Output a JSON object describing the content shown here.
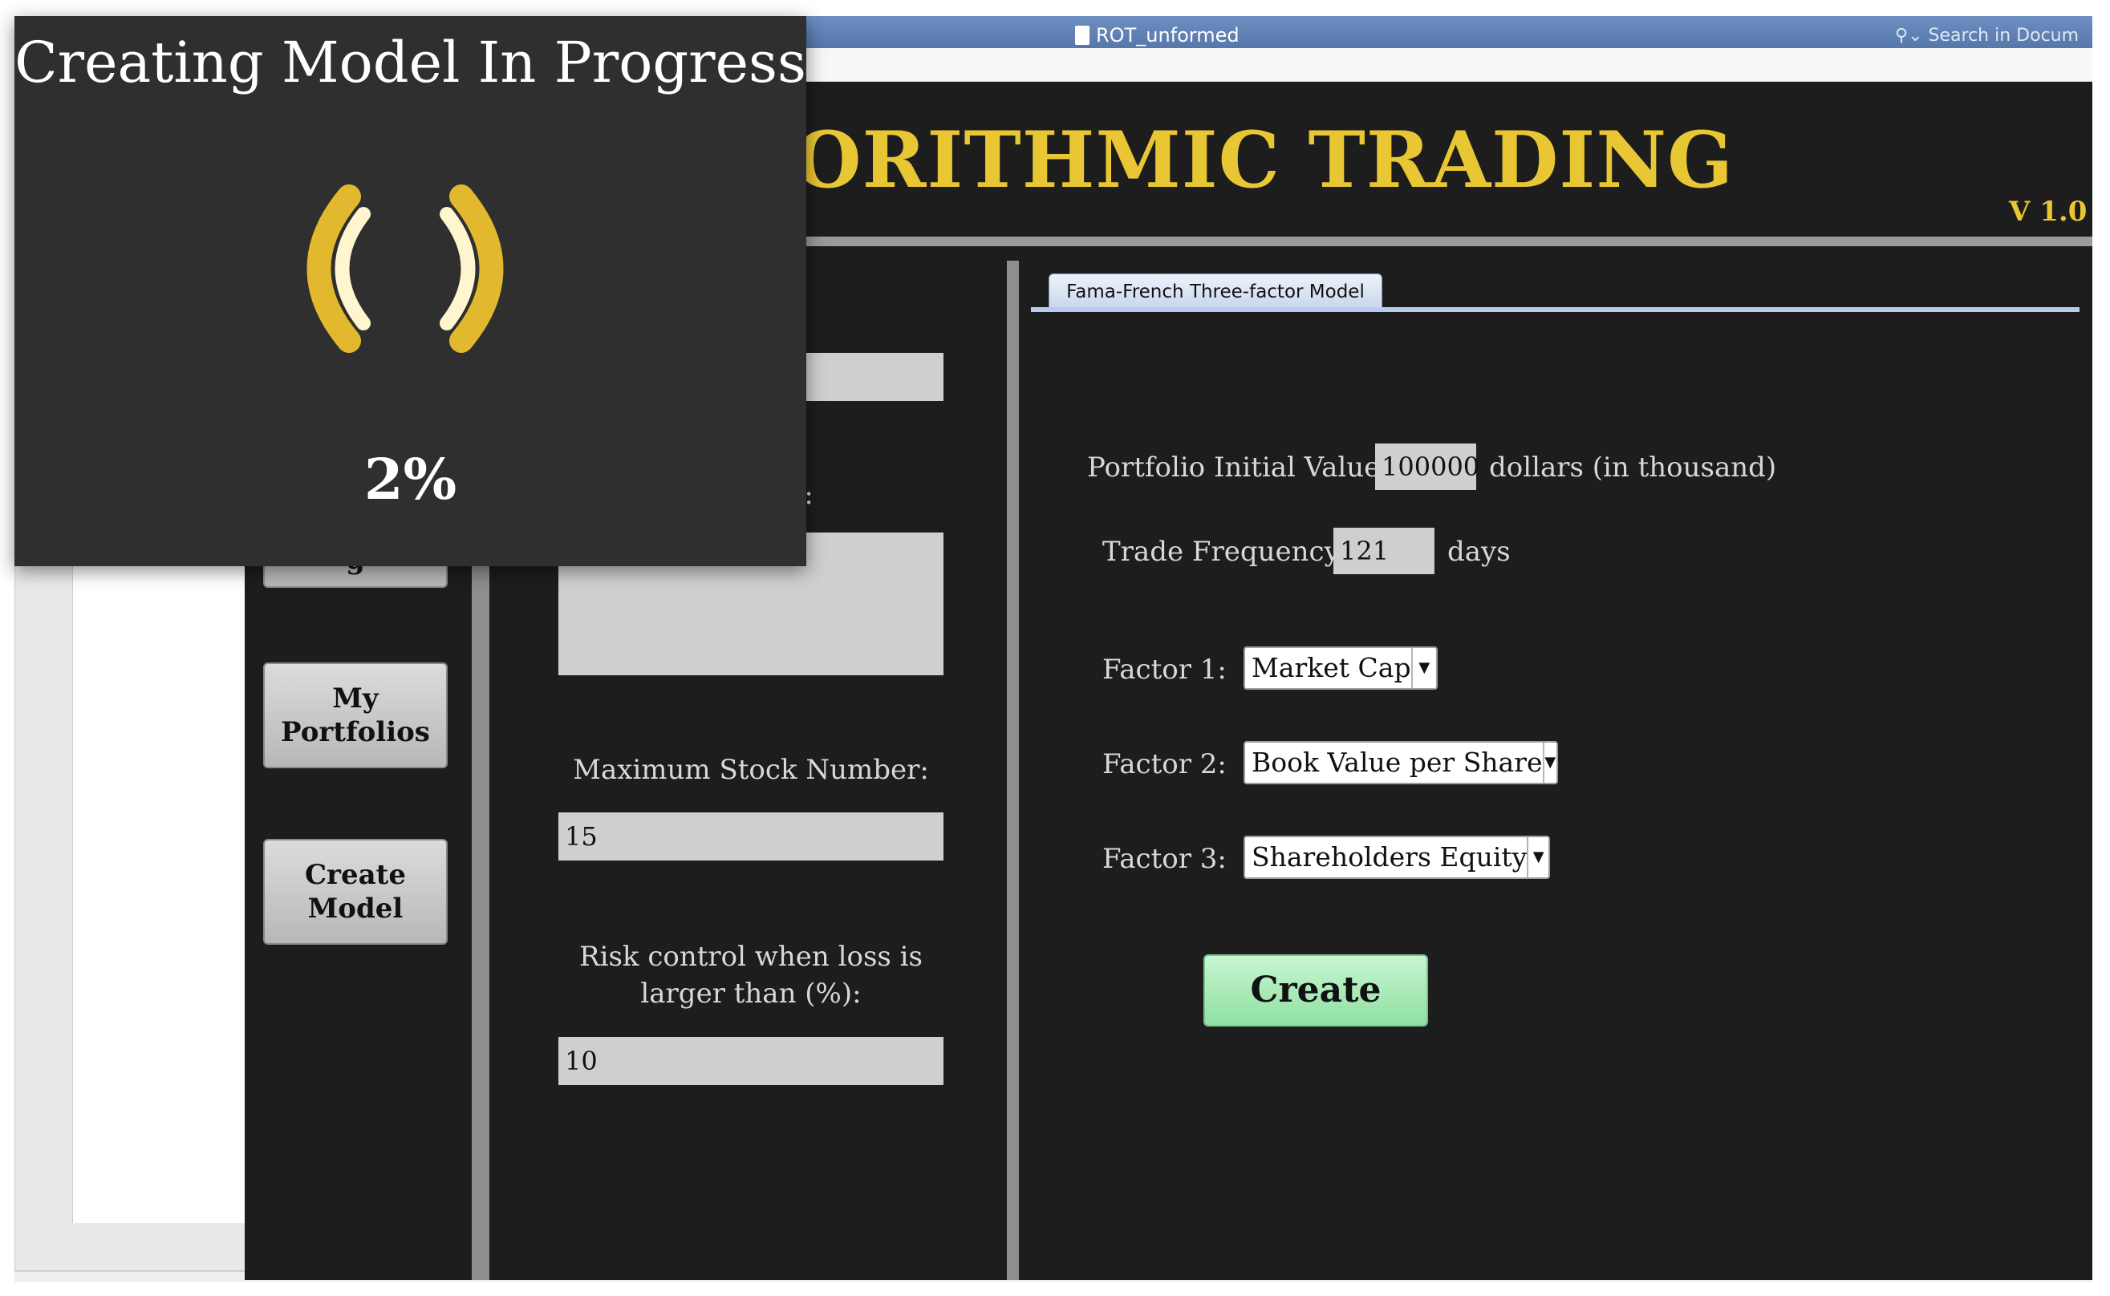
{
  "background_window": {
    "title": "ROT_unformed",
    "search_placeholder": "Search in Docum"
  },
  "app": {
    "title": "ORITHMIC TRADING",
    "version": "V 1.0"
  },
  "nav": {
    "items": [
      {
        "label": "g"
      },
      {
        "label": "My\nPortfolios"
      },
      {
        "label": "Create\nModel"
      }
    ]
  },
  "form": {
    "partial_label": "on:",
    "max_stock_label": "Maximum Stock Number:",
    "max_stock_value": "15",
    "risk_label_line1": "Risk control when loss is",
    "risk_label_line2": "larger than (%):",
    "risk_value": "10"
  },
  "model_panel": {
    "tab_label": "Fama-French Three-factor Model",
    "initial_value_label": "Portfolio Initial Value:",
    "initial_value": "100000",
    "initial_value_unit": "dollars (in thousand)",
    "trade_freq_label": "Trade Frequency:",
    "trade_freq_value": "121",
    "trade_freq_unit": "days",
    "factors": [
      {
        "label": "Factor 1:",
        "value": "Market Cap"
      },
      {
        "label": "Factor 2:",
        "value": "Book Value per Share"
      },
      {
        "label": "Factor 3:",
        "value": "Shareholders Equity"
      }
    ],
    "create_label": "Create"
  },
  "progress_dialog": {
    "title": "Creating Model In Progress",
    "percent_text": "2%",
    "progress_percent": 2,
    "spinner_outer_color": "#e2b92e",
    "spinner_inner_color": "#fff6cf"
  }
}
